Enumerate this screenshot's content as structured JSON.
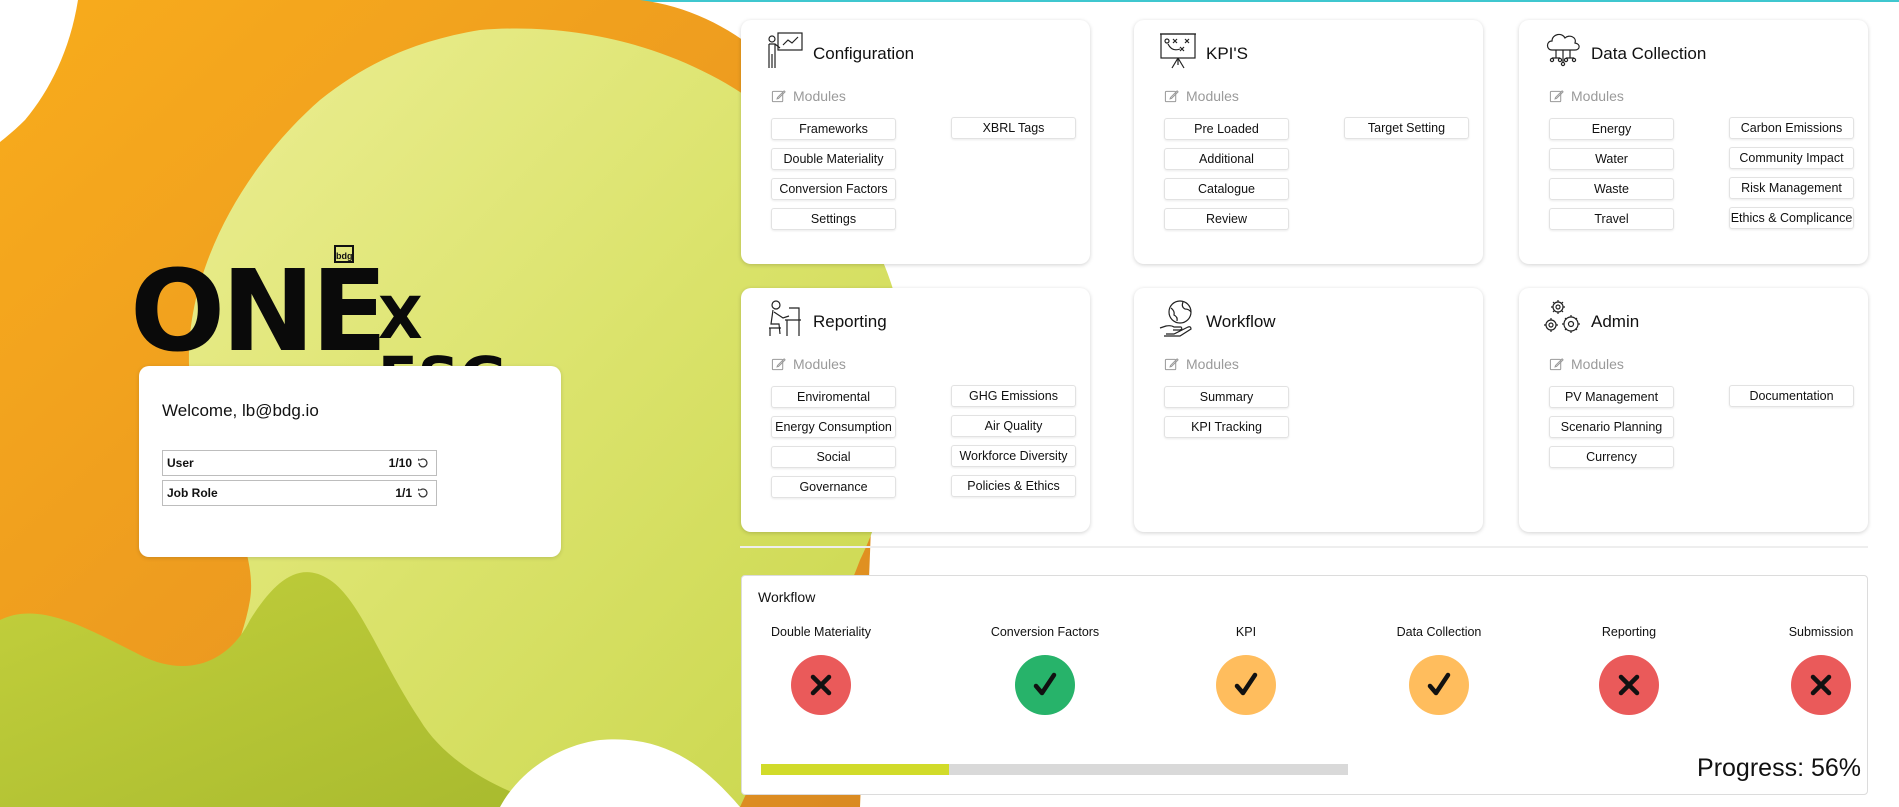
{
  "brand": {
    "name": "ONE",
    "badge": "bdg",
    "suffix": "X ESG"
  },
  "welcome": {
    "text": "Welcome, lb@bdg.io",
    "limits": [
      {
        "label": "User",
        "value": "1/10"
      },
      {
        "label": "Job Role",
        "value": "1/1"
      }
    ]
  },
  "modules_label": "Modules",
  "cards": [
    {
      "title": "Configuration",
      "icon": "presentation-icon",
      "col1": [
        "Frameworks",
        "Double Materiality",
        "Conversion Factors",
        "Settings"
      ],
      "col2": [
        "XBRL Tags"
      ]
    },
    {
      "title": "KPI'S",
      "icon": "strategy-board-icon",
      "col1": [
        "Pre Loaded",
        "Additional",
        "Catalogue",
        "Review"
      ],
      "col2": [
        "Target Setting"
      ]
    },
    {
      "title": "Data Collection",
      "icon": "cloud-network-icon",
      "col1": [
        "Energy",
        "Water",
        "Waste",
        "Travel"
      ],
      "col2": [
        "Carbon Emissions",
        "Community Impact",
        "Risk Management",
        "Ethics & Complicance"
      ]
    },
    {
      "title": "Reporting",
      "icon": "desk-worker-icon",
      "col1": [
        "Enviromental",
        "Energy Consumption",
        "Social",
        "Governance"
      ],
      "col2": [
        "GHG Emissions",
        "Air Quality",
        "Workforce Diversity",
        "Policies & Ethics"
      ]
    },
    {
      "title": "Workflow",
      "icon": "globe-hand-icon",
      "col1": [
        "Summary",
        "KPI Tracking"
      ],
      "col2": []
    },
    {
      "title": "Admin",
      "icon": "gears-icon",
      "col1": [
        "PV Management",
        "Scenario Planning",
        "Currency"
      ],
      "col2": [
        "Documentation"
      ]
    }
  ],
  "workflow": {
    "title": "Workflow",
    "steps": [
      {
        "label": "Double Materiality",
        "status": "failed"
      },
      {
        "label": "Conversion Factors",
        "status": "complete"
      },
      {
        "label": "KPI",
        "status": "in-progress"
      },
      {
        "label": "Data Collection",
        "status": "in-progress"
      },
      {
        "label": "Reporting",
        "status": "failed"
      },
      {
        "label": "Submission",
        "status": "failed"
      }
    ],
    "status_colors": {
      "failed": "#ea5a5a",
      "complete": "#27b36a",
      "in-progress": "#ffbd5d"
    },
    "progress_percent": 56,
    "bar_fill_fraction": 0.32,
    "progress_label": "Progress: 56%"
  },
  "colors": {
    "accent_lime": "#d1db2a",
    "blob_orange": "#f5a61d",
    "blob_yellow": "#e7ea85",
    "blob_olive": "#b2c232"
  }
}
